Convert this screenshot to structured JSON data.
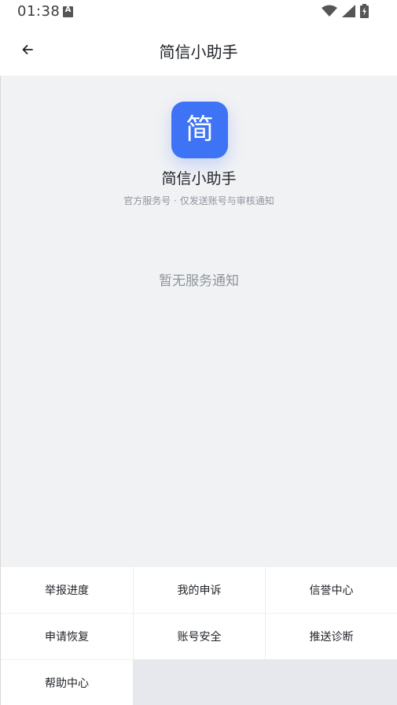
{
  "status_bar": {
    "time": "01:38",
    "notification_badge": "A",
    "icons": [
      "wifi-icon",
      "signal-icon",
      "battery-charging-icon"
    ]
  },
  "header": {
    "back_icon": "back-arrow-icon",
    "title": "简信小助手"
  },
  "profile": {
    "logo_char": "简",
    "name": "简信小助手",
    "description": "官方服务号 · 仅发送账号与审核通知",
    "brand_color": "#3f73f5"
  },
  "empty_state": {
    "text": "暂无服务通知"
  },
  "menu": {
    "items": [
      {
        "label": "举报进度"
      },
      {
        "label": "我的申诉"
      },
      {
        "label": "信誉中心"
      },
      {
        "label": "申请恢复"
      },
      {
        "label": "账号安全"
      },
      {
        "label": "推送诊断"
      },
      {
        "label": "帮助中心"
      }
    ]
  }
}
